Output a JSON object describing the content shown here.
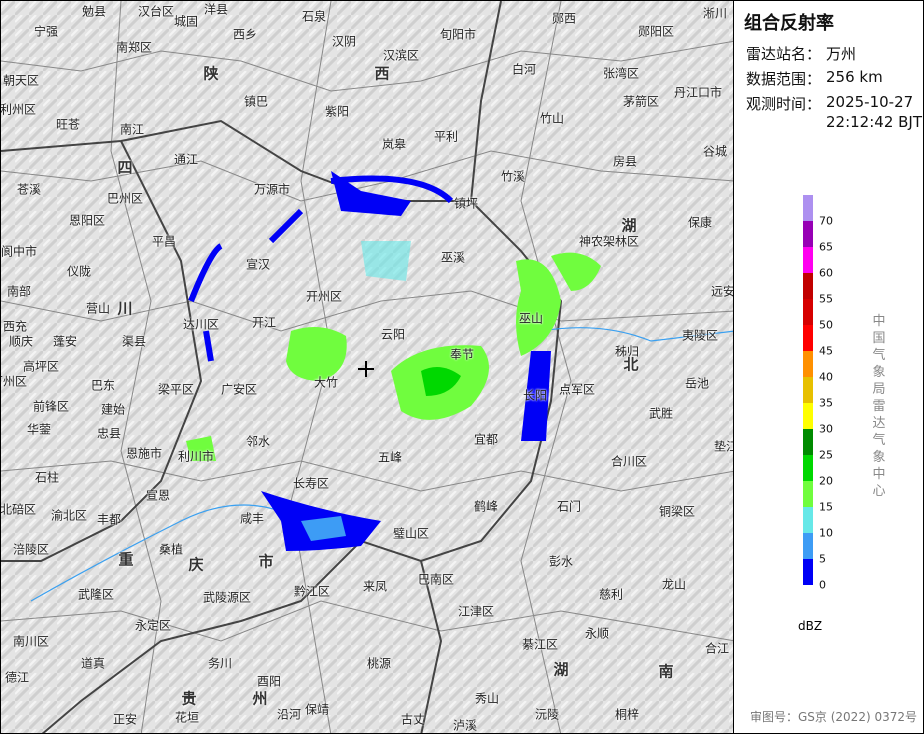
{
  "panel": {
    "title": "组合反射率",
    "station_label": "雷达站名：",
    "station": "万州",
    "range_label": "数据范围：",
    "range": "256 km",
    "time_label": "观测时间：",
    "date": "2025-10-27",
    "time": "22:12:42 BJT",
    "unit": "dBZ",
    "credit": "中国气象局雷达气象中心",
    "review": "审图号：GS京 (2022) 0372号"
  },
  "legend": {
    "ticks": [
      "70",
      "65",
      "60",
      "55",
      "50",
      "45",
      "40",
      "35",
      "30",
      "25",
      "20",
      "15",
      "10",
      "5",
      "0"
    ],
    "colors": [
      "#ad90f0",
      "#9700b5",
      "#ff00f0",
      "#c10000",
      "#d60000",
      "#ff0000",
      "#ff9000",
      "#e7c000",
      "#ffff00",
      "#008b00",
      "#00d800",
      "#70fd3e",
      "#66e8e8",
      "#3d9cf5",
      "#0000f6"
    ]
  },
  "map": {
    "labels": [
      "宁强",
      "勉县",
      "汉台区",
      "城固",
      "洋县",
      "石泉",
      "西乡",
      "南郑区",
      "汉阴",
      "汉滨区",
      "旬阳市",
      "郧西",
      "郧阳区",
      "淅川",
      "白河",
      "张湾区",
      "丹江口市",
      "朝天区",
      "镇巴",
      "紫阳",
      "旺苍",
      "南江",
      "利州区",
      "竹山",
      "茅箭区",
      "岚皋",
      "平利",
      "房县",
      "谷城",
      "通江",
      "万源市",
      "竹溪",
      "镇坪",
      "苍溪",
      "巴州区",
      "恩阳区",
      "平昌",
      "保康",
      "阆中市",
      "仪陇",
      "宣汉",
      "巫溪",
      "神农架林区",
      "南部",
      "营山",
      "开州区",
      "远安",
      "达川区",
      "开江",
      "西充",
      "顺庆",
      "蓬安",
      "渠县",
      "云阳",
      "奉节",
      "巫山",
      "秭归",
      "夷陵区",
      "高坪区",
      "万州区",
      "大竹",
      "梁平区",
      "广安区",
      "巴东",
      "点军区",
      "岳池",
      "前锋区",
      "建始",
      "长阳",
      "武胜",
      "华蓥",
      "忠县",
      "邻水",
      "恩施市",
      "宜都",
      "垫江",
      "利川市",
      "五峰",
      "合川区",
      "石柱",
      "长寿区",
      "宣恩",
      "鹤峰",
      "石门",
      "铜梁区",
      "北碚区",
      "渝北区",
      "丰都",
      "咸丰",
      "璧山区",
      "涪陵区",
      "桑植",
      "彭水",
      "黔江区",
      "来凤",
      "巴南区",
      "武隆区",
      "武陵源区",
      "慈利",
      "龙山",
      "江津区",
      "南川区",
      "永定区",
      "永顺",
      "綦江区",
      "道真",
      "务川",
      "酉阳",
      "桃源",
      "合江",
      "德江",
      "沿河",
      "保靖",
      "秀山",
      "古丈",
      "沅陵",
      "桐梓",
      "正安",
      "花垣",
      "泸溪"
    ],
    "provinces": [
      "陕",
      "西",
      "四",
      "川",
      "湖",
      "北",
      "重",
      "庆",
      "市",
      "湖",
      "南",
      "贵",
      "州"
    ]
  }
}
